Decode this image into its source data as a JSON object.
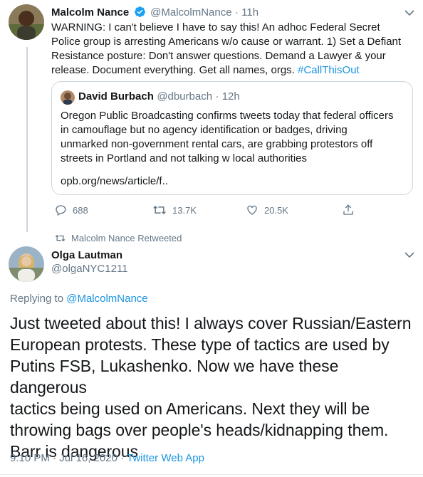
{
  "tweet1": {
    "name": "Malcolm Nance",
    "handle": "@MalcolmNance",
    "time": "· 11h",
    "text_lines": [
      "WARNING: I can't believe I have to say this! An adhoc Federal Secret",
      "Police group is arresting Americans w/o cause or warrant. 1) Set a Defiant",
      "Resistance posture:  Don't answer questions. Demand a Lawyer & your",
      "release. Document everything. Get all names, orgs."
    ],
    "hashtag": "#CallThisOut",
    "quote": {
      "name": "David Burbach",
      "handle": "@dburbach",
      "time": "· 12h",
      "text_lines": [
        "Oregon Public Broadcasting confirms tweets today that federal officers",
        "in camouflage but no agency identification or badges, driving",
        "unmarked non-government rental cars, are grabbing protestors off",
        "streets in Portland and not talking w local authorities"
      ],
      "link": "opb.org/news/article/f.."
    },
    "replies": "688",
    "retweets": "13.7K",
    "likes": "20.5K",
    "icons": [
      "verified-icon",
      "chevron-down-icon",
      "reply-icon",
      "retweet-icon",
      "like-icon",
      "share-icon"
    ]
  },
  "retweet_context": "Malcolm Nance Retweeted",
  "tweet2": {
    "name": "Olga Lautman",
    "handle": "@olgaNYC1211",
    "replying_prefix": "Replying to",
    "replying_handle": "@MalcolmNance",
    "text_lines": [
      "Just tweeted about this! I always cover Russian/Eastern",
      "European protests. These type of tactics are used by",
      "Putins FSB, Lukashenko. Now we have these dangerous",
      "tactics being used on Americans. Next they will be",
      "throwing bags over people's heads/kidnapping them.",
      "Barr is dangerous"
    ],
    "timestamp": "9:10 PM · Jul 16, 2020 ·",
    "source": "Twitter Web App"
  },
  "colors": {
    "accent": "#1b95e0",
    "muted": "#657786",
    "text": "#14171a",
    "border": "#ccd6dd"
  }
}
